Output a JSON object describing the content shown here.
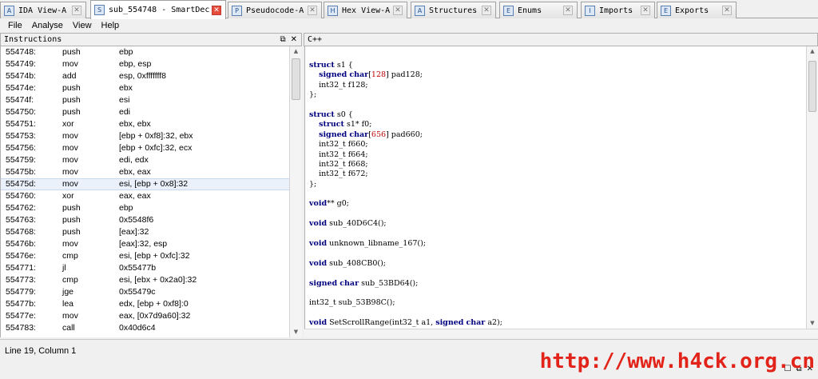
{
  "tabs": [
    {
      "label": "IDA View-A",
      "icon": "disassembly-icon",
      "active": false
    },
    {
      "label": "sub_554748 - SmartDec",
      "icon": "smartdec-icon",
      "active": true
    },
    {
      "label": "Pseudocode-A",
      "icon": "pseudocode-icon",
      "active": false
    },
    {
      "label": "Hex View-A",
      "icon": "hex-view-icon",
      "active": false
    },
    {
      "label": "Structures",
      "icon": "structures-icon",
      "active": false
    },
    {
      "label": "Enums",
      "icon": "enums-icon",
      "active": false
    },
    {
      "label": "Imports",
      "icon": "imports-icon",
      "active": false
    },
    {
      "label": "Exports",
      "icon": "exports-icon",
      "active": false
    }
  ],
  "menu": [
    "File",
    "Analyse",
    "View",
    "Help"
  ],
  "instructions_pane": {
    "title": "Instructions",
    "rows": [
      {
        "addr": "554748:",
        "mnemonic": "push",
        "operands": "ebp"
      },
      {
        "addr": "554749:",
        "mnemonic": "mov",
        "operands": "ebp, esp"
      },
      {
        "addr": "55474b:",
        "mnemonic": "add",
        "operands": "esp, 0xfffffff8"
      },
      {
        "addr": "55474e:",
        "mnemonic": "push",
        "operands": "ebx"
      },
      {
        "addr": "55474f:",
        "mnemonic": "push",
        "operands": "esi"
      },
      {
        "addr": "554750:",
        "mnemonic": "push",
        "operands": "edi"
      },
      {
        "addr": "554751:",
        "mnemonic": "xor",
        "operands": "ebx, ebx"
      },
      {
        "addr": "554753:",
        "mnemonic": "mov",
        "operands": "[ebp + 0xf8]:32, ebx"
      },
      {
        "addr": "554756:",
        "mnemonic": "mov",
        "operands": "[ebp + 0xfc]:32, ecx"
      },
      {
        "addr": "554759:",
        "mnemonic": "mov",
        "operands": "edi, edx"
      },
      {
        "addr": "55475b:",
        "mnemonic": "mov",
        "operands": "ebx, eax"
      },
      {
        "addr": "55475d:",
        "mnemonic": "mov",
        "operands": "esi, [ebp + 0x8]:32",
        "selected": true
      },
      {
        "addr": "554760:",
        "mnemonic": "xor",
        "operands": "eax, eax"
      },
      {
        "addr": "554762:",
        "mnemonic": "push",
        "operands": "ebp"
      },
      {
        "addr": "554763:",
        "mnemonic": "push",
        "operands": "0x5548f6"
      },
      {
        "addr": "554768:",
        "mnemonic": "push",
        "operands": "[eax]:32"
      },
      {
        "addr": "55476b:",
        "mnemonic": "mov",
        "operands": "[eax]:32, esp"
      },
      {
        "addr": "55476e:",
        "mnemonic": "cmp",
        "operands": "esi, [ebp + 0xfc]:32"
      },
      {
        "addr": "554771:",
        "mnemonic": "jl",
        "operands": "0x55477b"
      },
      {
        "addr": "554773:",
        "mnemonic": "cmp",
        "operands": "esi, [ebx + 0x2a0]:32"
      },
      {
        "addr": "554779:",
        "mnemonic": "jge",
        "operands": "0x55479c"
      },
      {
        "addr": "55477b:",
        "mnemonic": "lea",
        "operands": "edx, [ebp + 0xf8]:0"
      },
      {
        "addr": "55477e:",
        "mnemonic": "mov",
        "operands": "eax, [0x7d9a60]:32"
      },
      {
        "addr": "554783:",
        "mnemonic": "call",
        "operands": "0x40d6c4"
      }
    ]
  },
  "code_pane": {
    "title": "C++",
    "lines": [
      "struct s1 {",
      "    signed char[128] pad128;",
      "    int32_t f128;",
      "};",
      "",
      "struct s0 {",
      "    struct s1* f0;",
      "    signed char[656] pad660;",
      "    int32_t f660;",
      "    int32_t f664;",
      "    int32_t f668;",
      "    int32_t f672;",
      "};",
      "",
      "void** g0;",
      "",
      "void sub_40D6C4();",
      "",
      "void unknown_libname_167();",
      "",
      "void sub_408CB0();",
      "",
      "signed char sub_53BD64();",
      "",
      "int32_t sub_53B98C();",
      "",
      "void SetScrollRange(int32_t a1, signed char a2);"
    ]
  },
  "status": {
    "text": "Line 19, Column 1"
  },
  "watermark": "http://www.h4ck.org.cn",
  "colors": {
    "keyword": "#000080",
    "number": "#c00000",
    "watermark": "#e2231a",
    "active_tab_close": "#e54c3c"
  }
}
